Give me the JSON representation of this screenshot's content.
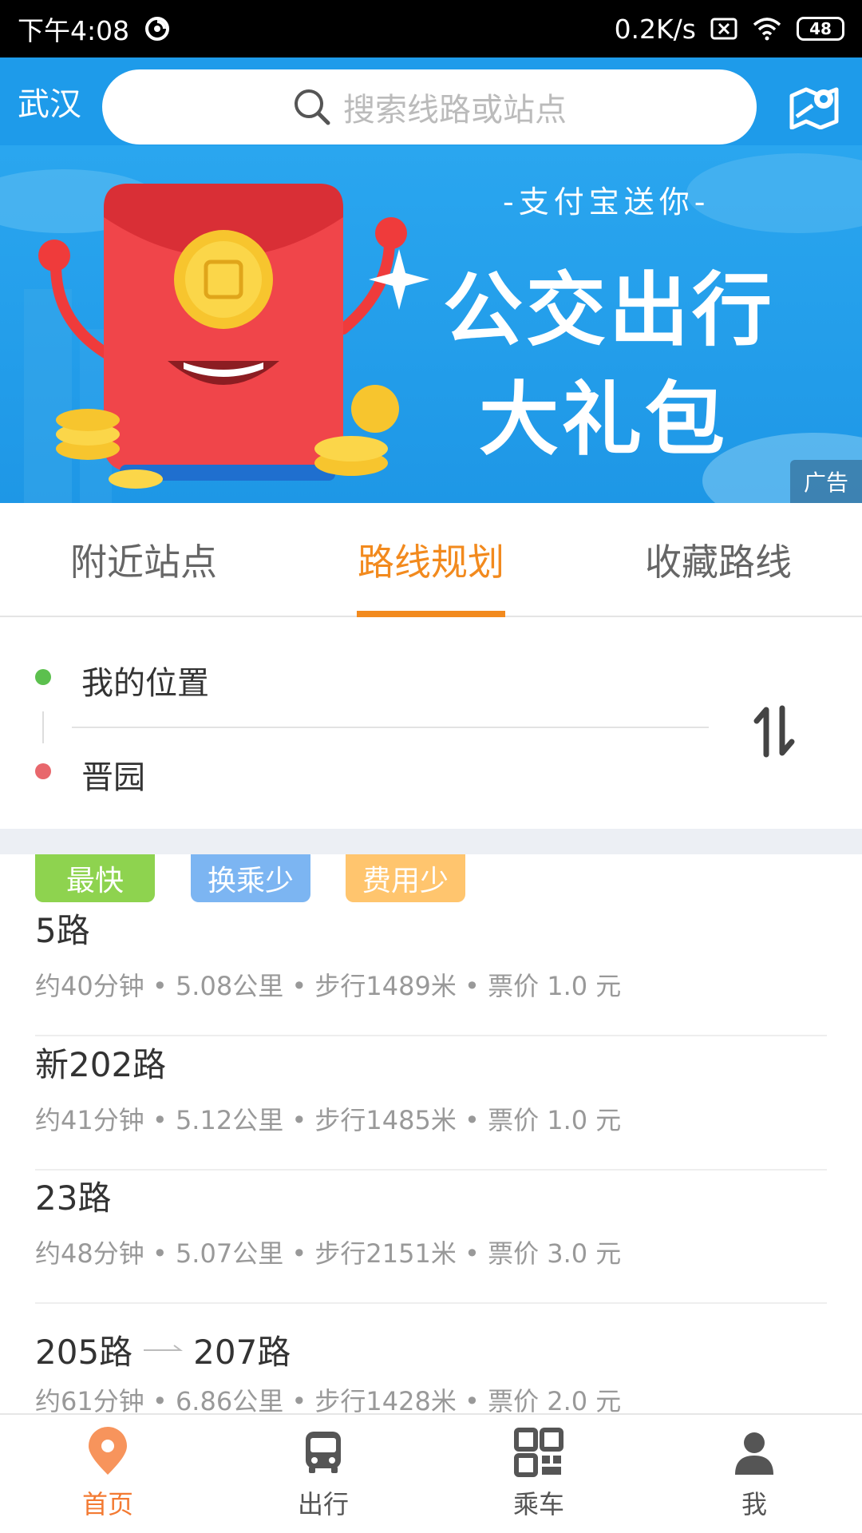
{
  "status_bar": {
    "time": "下午4:08",
    "speed": "0.2K/s",
    "battery": "48"
  },
  "header": {
    "city": "武汉",
    "search_placeholder": "搜索线路或站点"
  },
  "banner": {
    "subtitle": "-支付宝送你-",
    "title_line1": "公交出行",
    "title_line2": "大礼包",
    "ad_label": "广告"
  },
  "tabs": [
    {
      "label": "附近站点",
      "active": false
    },
    {
      "label": "路线规划",
      "active": true
    },
    {
      "label": "收藏路线",
      "active": false
    }
  ],
  "route_input": {
    "from": "我的位置",
    "to": "晋园"
  },
  "tags": {
    "fast": "最快",
    "transfer": "换乘少",
    "cost": "费用少"
  },
  "results": [
    {
      "name": "5路",
      "meta": "约40分钟 • 5.08公里 • 步行1489米 • 票价  1.0  元"
    },
    {
      "name": "新202路",
      "meta": "约41分钟 • 5.12公里 • 步行1485米 • 票价  1.0  元"
    },
    {
      "name": "23路",
      "meta": "约48分钟 • 5.07公里 • 步行2151米 • 票价  3.0  元"
    },
    {
      "name_a": "205路",
      "name_b": "207路",
      "meta": "约61分钟 • 6.86公里 • 步行1428米 • 票价  2.0  元"
    }
  ],
  "bottom_nav": [
    {
      "label": "首页",
      "icon": "location-pin-icon",
      "active": true
    },
    {
      "label": "出行",
      "icon": "bus-icon",
      "active": false
    },
    {
      "label": "乘车",
      "icon": "qr-code-icon",
      "active": false
    },
    {
      "label": "我",
      "icon": "user-icon",
      "active": false
    }
  ],
  "colors": {
    "primary": "#1e9bea",
    "accent": "#f28a1e",
    "green": "#5cc04e",
    "red": "#e8676c"
  }
}
